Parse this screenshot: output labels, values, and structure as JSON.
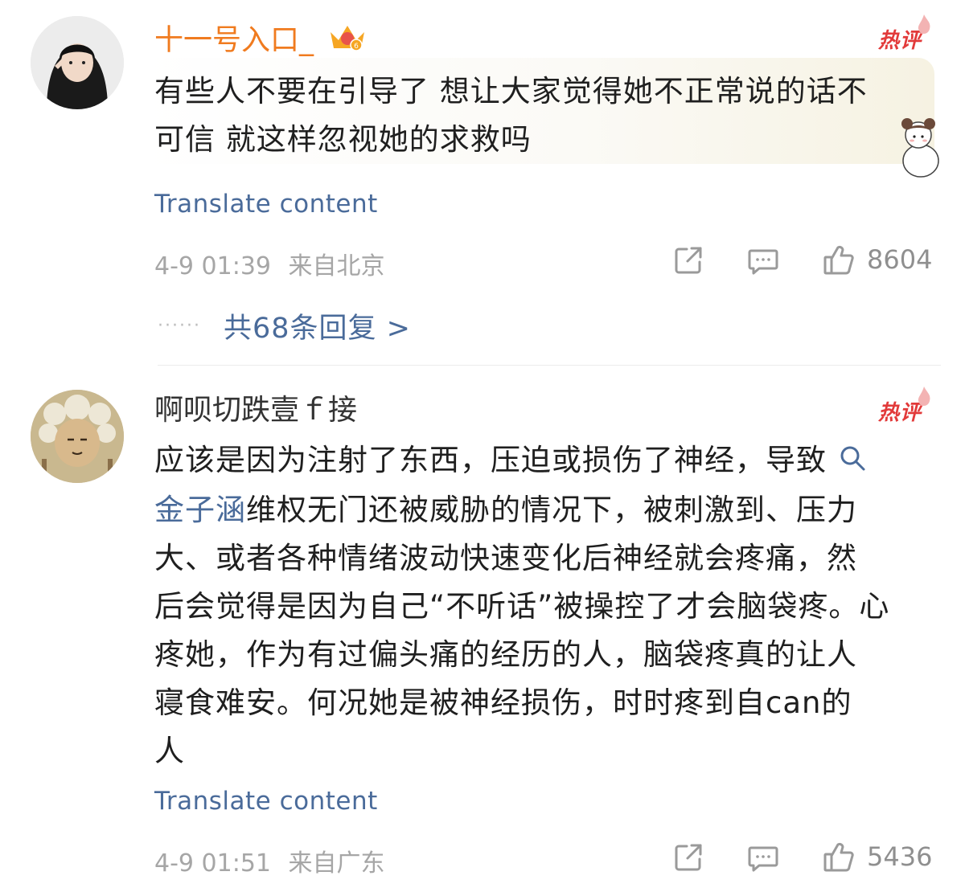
{
  "comments": [
    {
      "username": "十一号入口_",
      "hot_label": "热评",
      "text_line1": "有些人不要在引导了 想让大家觉得她不正常说的话不",
      "text_line2": "可信 就这样忽视她的求救吗",
      "translate": "Translate content",
      "timestamp": "4-9 01:39",
      "location": "来自北京",
      "likes": "8604",
      "replies": "共68条回复 >",
      "replies_dots": "······",
      "username_color": "#f07b1f"
    },
    {
      "username": "啊呗切跌壹ｆ接",
      "hot_label": "热评",
      "text_line1": "应该是因为注射了东西，压迫或损伤了神经，导致",
      "link_text": "金子涵",
      "text_line2_rest": "维权无门还被威胁的情况下，被刺激到、压力",
      "text_line3": "大、或者各种情绪波动快速变化后神经就会疼痛，然",
      "text_line4": "后会觉得是因为自己“不听话”被操控了才会脑袋疼。心",
      "text_line5": "疼她，作为有过偏头痛的经历的人，脑袋疼真的让人",
      "text_line6": "寝食难安。何况她是被神经损伤，时时疼到自can的",
      "text_line7": "人",
      "translate": "Translate content",
      "timestamp": "4-9 01:51",
      "location": "来自广东",
      "likes": "5436",
      "username_color": "#333333"
    }
  ],
  "icons": {
    "share": "share-icon",
    "comment": "comment-icon",
    "like": "thumbs-up-icon",
    "search": "search-icon"
  },
  "colors": {
    "link": "#4a6b9a",
    "hot": "#e23a3a",
    "meta": "#a6a6a6"
  }
}
